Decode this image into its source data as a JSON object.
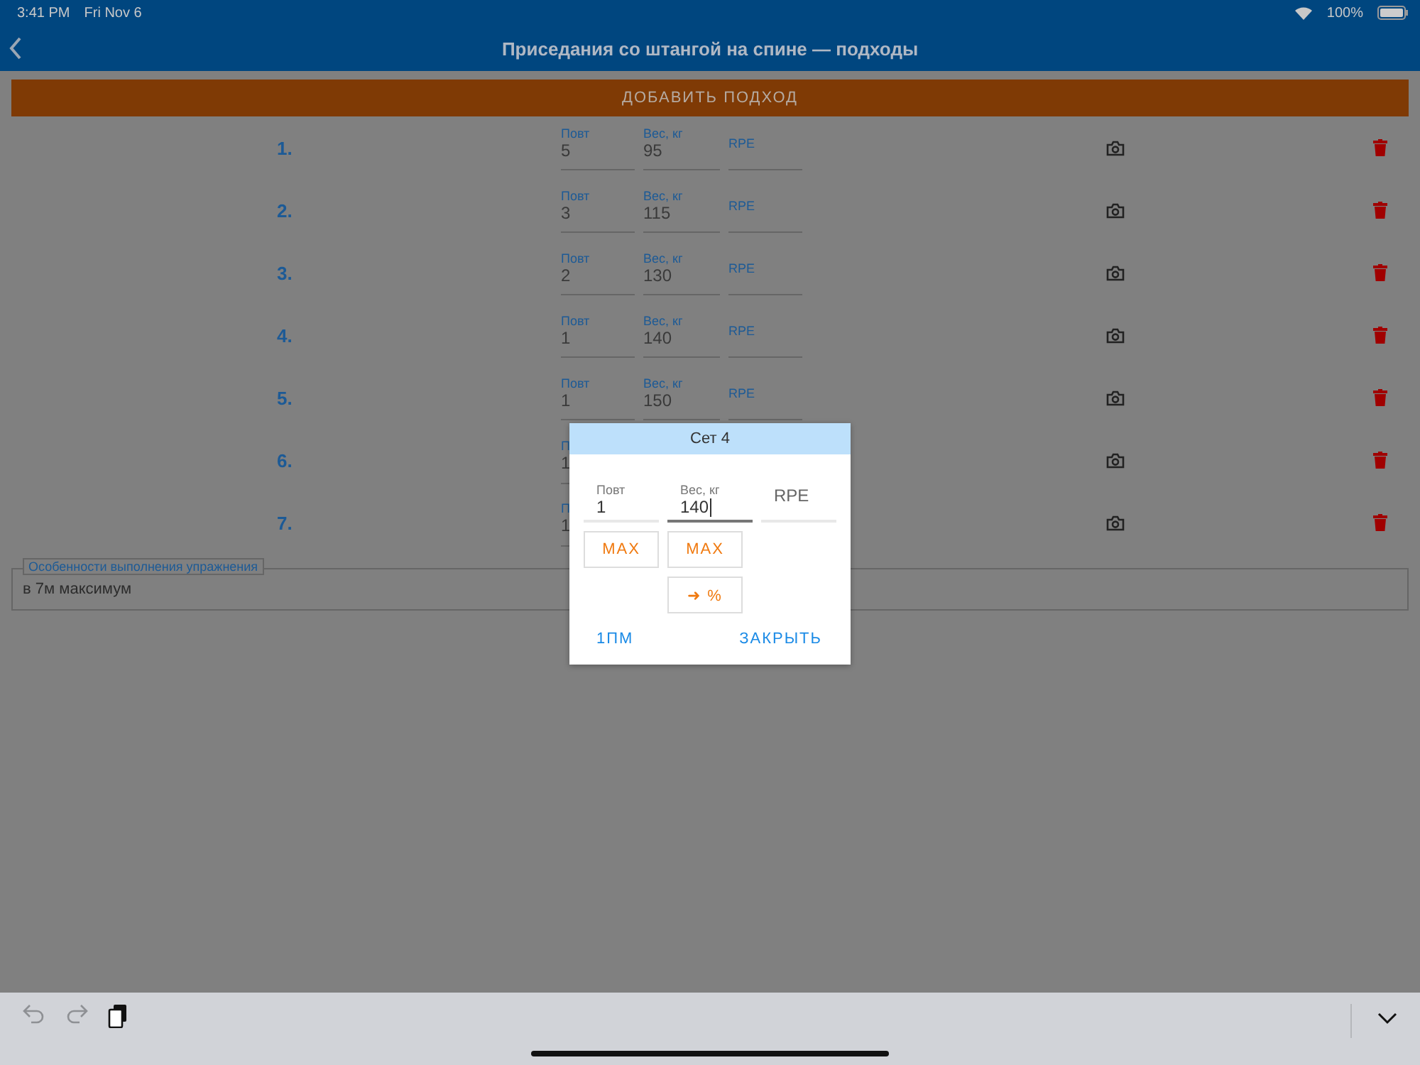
{
  "status_bar": {
    "time": "3:41 PM",
    "date": "Fri Nov 6",
    "battery": "100%"
  },
  "header": {
    "title": "Приседания со штангой на спине — подходы"
  },
  "add_button": "ДОБАВИТЬ ПОДХОД",
  "sets": [
    {
      "number": "1.",
      "fields": [
        {
          "label": "Повт",
          "value": "5"
        },
        {
          "label": "Вес, кг",
          "value": "95"
        },
        {
          "label": "RPE"
        }
      ]
    },
    {
      "number": "2.",
      "fields": [
        {
          "label": "Повт",
          "value": "3"
        },
        {
          "label": "Вес, кг",
          "value": "115"
        },
        {
          "label": "RPE"
        }
      ]
    },
    {
      "number": "3.",
      "fields": [
        {
          "label": "Повт",
          "value": "2"
        },
        {
          "label": "Вес, кг",
          "value": "130"
        },
        {
          "label": "RPE"
        }
      ]
    },
    {
      "number": "4.",
      "fields": [
        {
          "label": "Повт",
          "value": "1"
        },
        {
          "label": "Вес, кг",
          "value": "140"
        },
        {
          "label": "RPE"
        }
      ]
    },
    {
      "number": "5.",
      "fields": [
        {
          "label": "Повт",
          "value": "1"
        },
        {
          "label": "Вес, кг",
          "value": "150"
        },
        {
          "label": "RPE"
        }
      ]
    },
    {
      "number": "6.",
      "fields": [
        {
          "label": "П",
          "value": "1"
        }
      ]
    },
    {
      "number": "7.",
      "fields": [
        {
          "label": "П",
          "value": "1"
        }
      ]
    }
  ],
  "notes": {
    "legend": "Особенности выполнения упражнения",
    "value": "в 7м максимум"
  },
  "dialog": {
    "title": "Сет 4",
    "fields": [
      {
        "label": "Повт",
        "value": "1",
        "focused": false
      },
      {
        "label": "Вес, кг",
        "value": "140",
        "focused": true
      },
      {
        "placeholder": "RPE",
        "focused": false
      }
    ],
    "max_buttons": [
      "MAX",
      "MAX"
    ],
    "percent_button": "➜ %",
    "one_rm": "1ПМ",
    "close": "ЗАКРЫТЬ"
  }
}
